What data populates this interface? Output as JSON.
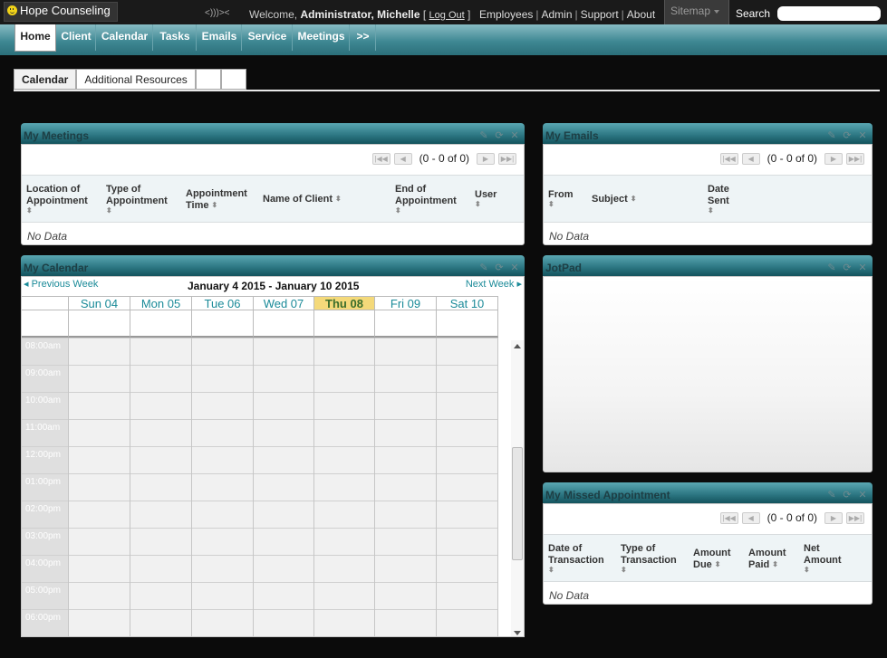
{
  "app": {
    "title": "Hope Counseling",
    "waves": "<)))><"
  },
  "welcome": {
    "prefix": "Welcome,",
    "user": "Administrator, Michelle",
    "logout": "Log Out"
  },
  "toplinks": [
    "Employees",
    "Admin",
    "Support",
    "About"
  ],
  "sitemap": "Sitemap",
  "search": {
    "label": "Search",
    "value": ""
  },
  "nav": [
    "Home",
    "Client",
    "Calendar",
    "Tasks",
    "Emails",
    "Service",
    "Meetings",
    ">>"
  ],
  "subtabs": [
    "Calendar",
    "Additional Resources",
    "",
    ""
  ],
  "meetings": {
    "title": "My Meetings",
    "pager": "(0 - 0 of 0)",
    "columns": [
      "Location of Appointment",
      "Type of Appointment",
      "Appointment Time",
      "Name of Client",
      "End of Appointment",
      "User"
    ],
    "nodata": "No Data"
  },
  "emails": {
    "title": "My Emails",
    "pager": "(0 - 0 of 0)",
    "columns": [
      "From",
      "Subject",
      "Date Sent"
    ],
    "nodata": "No Data"
  },
  "calendar": {
    "title": "My Calendar",
    "prev": "Previous Week",
    "next": "Next Week",
    "range": "January 4 2015 - January 10 2015",
    "days": [
      "Sun 04",
      "Mon 05",
      "Tue 06",
      "Wed 07",
      "Thu 08",
      "Fri 09",
      "Sat 10"
    ],
    "today_index": 4,
    "times": [
      "08:00am",
      "09:00am",
      "10:00am",
      "11:00am",
      "12:00pm",
      "01:00pm",
      "02:00pm",
      "03:00pm",
      "04:00pm",
      "05:00pm",
      "06:00pm"
    ]
  },
  "jotpad": {
    "title": "JotPad"
  },
  "missed": {
    "title": "My Missed Appointment",
    "pager": "(0 - 0 of 0)",
    "columns": [
      "Date of Transaction",
      "Type of Transaction",
      "Amount Due",
      "Amount Paid",
      "Net Amount"
    ],
    "nodata": "No Data"
  },
  "colors": {
    "accent": "#2b7581",
    "today": "#f4d97a",
    "link": "#1a8a98"
  }
}
